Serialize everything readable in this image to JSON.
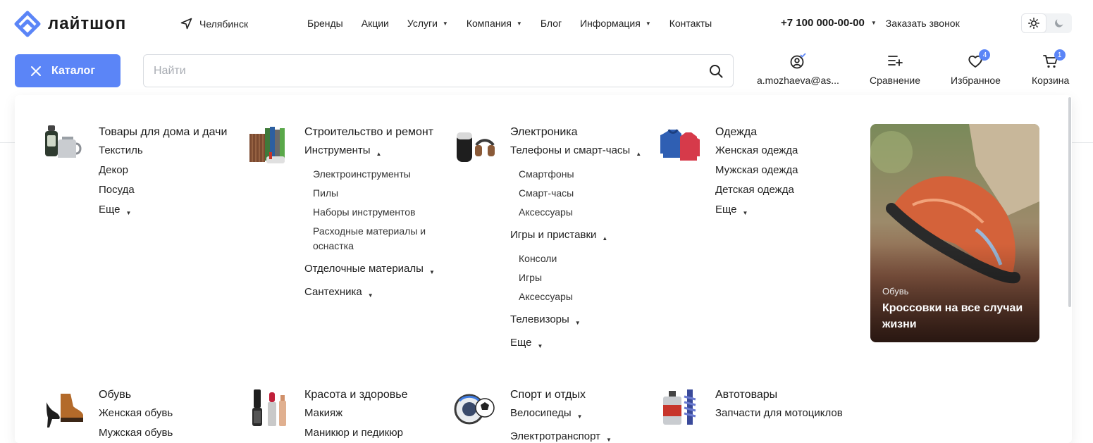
{
  "header": {
    "logo_text": "лайтшоп",
    "city": "Челябинск",
    "nav": [
      {
        "label": "Бренды",
        "dropdown": false
      },
      {
        "label": "Акции",
        "dropdown": false
      },
      {
        "label": "Услуги",
        "dropdown": true
      },
      {
        "label": "Компания",
        "dropdown": true
      },
      {
        "label": "Блог",
        "dropdown": false
      },
      {
        "label": "Информация",
        "dropdown": true
      },
      {
        "label": "Контакты",
        "dropdown": false
      }
    ],
    "phone": "+7 100 000-00-00",
    "callback": "Заказать звонок",
    "theme_active": "light"
  },
  "toolbar": {
    "catalog_label": "Каталог",
    "search_placeholder": "Найти",
    "account_label": "a.mozhaeva@as...",
    "compare_label": "Сравнение",
    "favorites_label": "Избранное",
    "favorites_count": "4",
    "cart_label": "Корзина",
    "cart_count": "1"
  },
  "catalog": {
    "categories": [
      {
        "title": "Товары для дома и дачи",
        "items": [
          {
            "label": "Текстиль"
          },
          {
            "label": "Декор"
          },
          {
            "label": "Посуда"
          },
          {
            "label": "Еще",
            "caret": "down"
          }
        ]
      },
      {
        "title": "Строительство и ремонт",
        "items": [
          {
            "label": "Инструменты",
            "caret": "up",
            "children": [
              "Электроинструменты",
              "Пилы",
              "Наборы инструментов",
              "Расходные материалы и оснастка"
            ]
          },
          {
            "label": "Отделочные материалы",
            "caret": "down"
          },
          {
            "label": "Сантехника",
            "caret": "down"
          }
        ]
      },
      {
        "title": "Электроника",
        "items": [
          {
            "label": "Телефоны и смарт-часы",
            "caret": "up",
            "children": [
              "Смартфоны",
              "Смарт-часы",
              "Аксессуары"
            ]
          },
          {
            "label": "Игры и приставки",
            "caret": "up",
            "children": [
              "Консоли",
              "Игры",
              "Аксессуары"
            ]
          },
          {
            "label": "Телевизоры",
            "caret": "down"
          },
          {
            "label": "Еще",
            "caret": "down"
          }
        ]
      },
      {
        "title": "Одежда",
        "items": [
          {
            "label": "Женская одежда"
          },
          {
            "label": "Мужская одежда"
          },
          {
            "label": "Детская одежда"
          },
          {
            "label": "Еще",
            "caret": "down"
          }
        ]
      },
      {
        "title": "Обувь",
        "items": [
          {
            "label": "Женская обувь"
          },
          {
            "label": "Мужская обувь"
          }
        ]
      },
      {
        "title": "Красота и здоровье",
        "items": [
          {
            "label": "Макияж"
          },
          {
            "label": "Маникюр и педикюр"
          }
        ]
      },
      {
        "title": "Спорт и отдых",
        "items": [
          {
            "label": "Велосипеды",
            "caret": "down"
          },
          {
            "label": "Электротранспорт",
            "caret": "down"
          }
        ]
      },
      {
        "title": "Автотовары",
        "items": [
          {
            "label": "Запчасти для мотоциклов"
          }
        ]
      }
    ],
    "promo": {
      "category": "Обувь",
      "title": "Кроссовки на все случаи жизни"
    }
  },
  "colors": {
    "accent": "#5b85f7",
    "text": "#1f1f1f",
    "border": "#d9dce1"
  }
}
